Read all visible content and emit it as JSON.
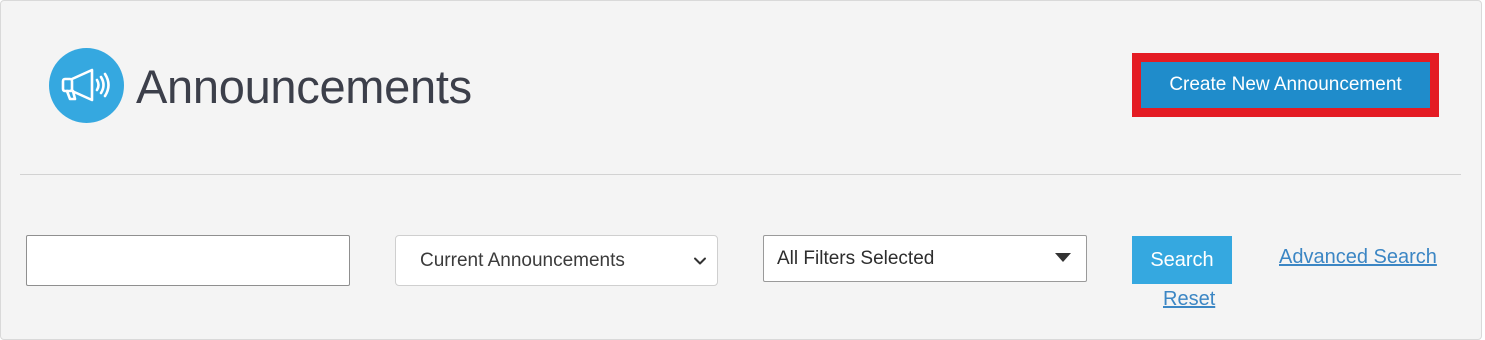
{
  "header": {
    "title": "Announcements",
    "icon": "megaphone-icon",
    "create_button_label": "Create New Announcement"
  },
  "filters": {
    "search_value": "",
    "status_select": {
      "selected": "Current Announcements",
      "icon": "chevron-down-icon"
    },
    "filter_select": {
      "selected": "All Filters Selected",
      "icon": "caret-down-icon"
    },
    "search_button_label": "Search",
    "reset_label": "Reset",
    "advanced_search_label": "Advanced Search"
  },
  "colors": {
    "panel_bg": "#f4f4f4",
    "icon_bg": "#35a8e0",
    "primary_button": "#1f8ccb",
    "search_button": "#35a8e0",
    "highlight_border": "#e41b23",
    "link": "#3b86c4",
    "title_text": "#3c3f4a"
  }
}
